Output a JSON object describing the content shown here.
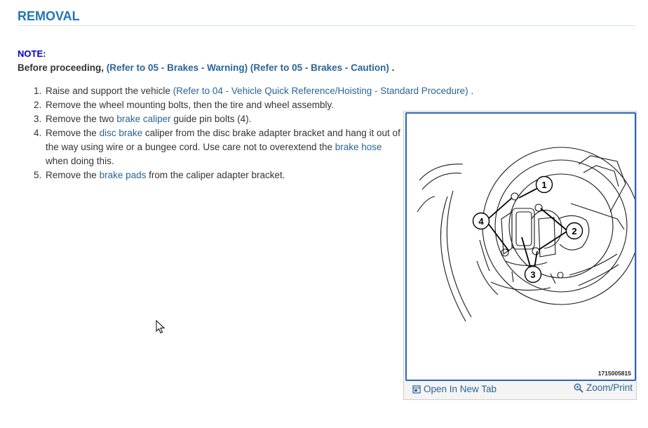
{
  "header": {
    "title": "REMOVAL"
  },
  "note": {
    "label": "NOTE:",
    "lead": "Before proceeding,",
    "link1": "(Refer to 05 - Brakes - Warning)",
    "link2": "(Refer to 05 - Brakes - Caution)",
    "end": "."
  },
  "steps": [
    {
      "num": "1.",
      "before": "Raise and support the vehicle",
      "link": "(Refer to 04 - Vehicle Quick Reference/Hoisting - Standard Procedure)",
      "after": "."
    },
    {
      "num": "2.",
      "text": "Remove the wheel mounting bolts, then the tire and wheel assembly."
    },
    {
      "num": "3.",
      "before": "Remove the two",
      "link": "brake caliper",
      "after": "guide pin bolts (4)."
    },
    {
      "num": "4.",
      "before": "Remove the",
      "link": "disc brake",
      "middle": "caliper from the disc brake adapter bracket and hang it out of the way using wire or a bungee cord. Use care not to overextend the",
      "link2": "brake hose",
      "after": "when doing this."
    },
    {
      "num": "5.",
      "before": "Remove the",
      "link": "brake pads",
      "after": "from the caliper adapter bracket."
    }
  ],
  "figure": {
    "callouts": [
      "1",
      "2",
      "3",
      "4"
    ],
    "id": "1715005815",
    "open_tab_label": "Open In New Tab",
    "zoom_label": "Zoom/Print",
    "open_tab_icon": "open-tab-icon",
    "zoom_icon": "magnifier-icon"
  }
}
